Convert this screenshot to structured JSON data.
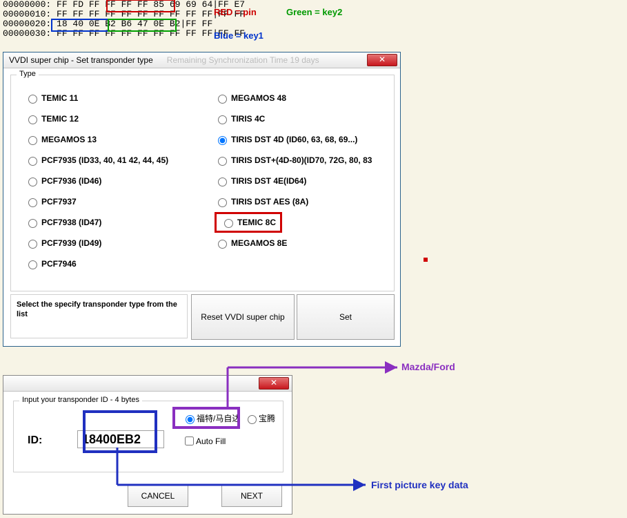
{
  "hexdump": {
    "rows": [
      "00000000: FF FD FF FF FF FF 85 69 69 64|FF E7",
      "00000010: FF FF FF FF FF FF FF FF FF FF|FF FF",
      "00000020: 18 40 0E B2 B6 47 0E B2|FF FF",
      "00000030: FF FF FF FF FF FF FF FF FF FF|FF FF"
    ]
  },
  "legend": {
    "red": "RED = pin",
    "green": "Green = key2",
    "blue": "Blue = key1"
  },
  "dialog1": {
    "title": "VVDI super chip - Set transponder type",
    "group_label": "Type",
    "left_options": [
      "TEMIC 11",
      "TEMIC 12",
      "MEGAMOS 13",
      "PCF7935 (ID33, 40, 41 42, 44, 45)",
      "PCF7936 (ID46)",
      "PCF7937",
      "PCF7938 (ID47)",
      "PCF7939 (ID49)",
      "PCF7946"
    ],
    "right_options": [
      "MEGAMOS 48",
      "TIRIS 4C",
      "TIRIS DST 4D (ID60, 63, 68, 69...)",
      "TIRIS DST+(4D-80)(ID70, 72G, 80, 83",
      "TIRIS DST 4E(ID64)",
      "TIRIS DST AES (8A)",
      "TEMIC 8C",
      "MEGAMOS 8E"
    ],
    "selected": "TEMIC 8C",
    "footer_text": "Select the specify transponder type from the list",
    "reset_btn": "Reset VVDI super chip",
    "set_btn": "Set"
  },
  "dialog2": {
    "group_label": "Input your transponder ID - 4 bytes",
    "id_label": "ID:",
    "id_value": "18400EB2",
    "radio1": "福特/马自达",
    "radio2": "宝腾",
    "autofill": "Auto Fill",
    "cancel": "CANCEL",
    "next": "NEXT"
  },
  "annotations": {
    "mazda_ford": "Mazda/Ford",
    "first_pic": "First picture key data"
  }
}
